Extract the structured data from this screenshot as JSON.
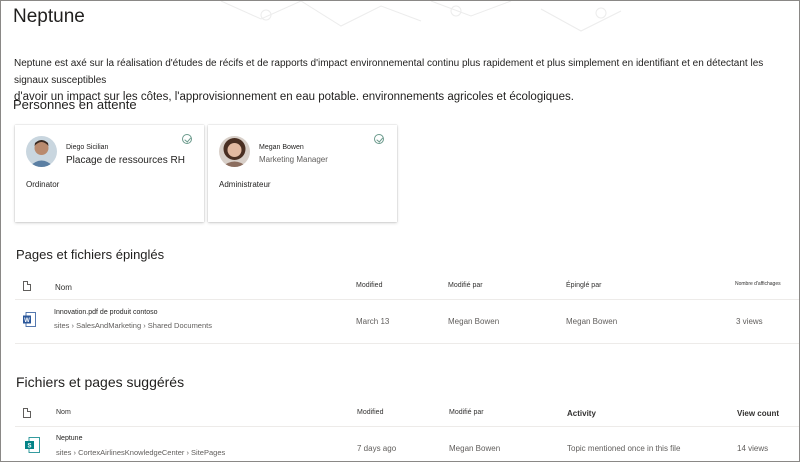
{
  "site": {
    "title": "Neptune",
    "description_line1": "Neptune est axé sur la réalisation d'études de récifs et de rapports d'impact environnemental continu plus rapidement et plus simplement en identifiant et en détectant les signaux susceptibles",
    "description_line2": "d'avoir un impact sur les côtes, l'approvisionnement en eau potable. environnements agricoles et écologiques."
  },
  "people_section": {
    "title": "Personnes en attente",
    "people": [
      {
        "name": "Diego Sicilian",
        "subtitle": "Placage de ressources RH",
        "role": "Ordinator",
        "avatar": "person-avatar-diego"
      },
      {
        "name": "Megan Bowen",
        "subtitle": "Marketing Manager",
        "role": "Administrateur",
        "avatar": "person-avatar-megan"
      }
    ]
  },
  "pinned_section": {
    "title": "Pages et fichiers épinglés",
    "columns": [
      "Nom",
      "Modified",
      "Modifié par",
      "Épinglé par",
      "Nombre d'affichages"
    ],
    "rows": [
      {
        "icon": "word-doc-icon",
        "title": "Innovation.pdf de produit contoso",
        "path": "sites › SalesAndMarketing › Shared Documents",
        "modified": "March 13",
        "modified_by": "Megan Bowen",
        "pinned_by": "Megan Bowen",
        "views": "3 views"
      }
    ]
  },
  "suggested_section": {
    "title": "Fichiers et pages suggérés",
    "columns": [
      "Nom",
      "Modified",
      "Modifié par",
      "Activity",
      "View count"
    ],
    "rows": [
      {
        "icon": "sharepoint-page-icon",
        "title": "Neptune",
        "path": "sites › CortexAirlinesKnowledgeCenter › SitePages",
        "modified": "7 days ago",
        "modified_by": "Megan Bowen",
        "activity": "Topic mentioned once in this file",
        "views": "14 views"
      }
    ]
  },
  "colors": {
    "accent": "#6b9a8c",
    "word_blue": "#2b579a",
    "sharepoint_teal": "#038387"
  }
}
